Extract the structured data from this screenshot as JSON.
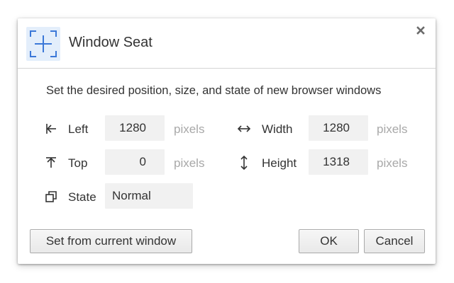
{
  "dialog": {
    "title": "Window Seat",
    "app_icon": "window-frame-icon",
    "close_icon": "close-icon"
  },
  "subtitle": "Set the desired position, size, and state of new browser windows",
  "fields": {
    "left": {
      "label": "Left",
      "value": "1280",
      "unit": "pixels",
      "icon": "align-left-edge-icon"
    },
    "top": {
      "label": "Top",
      "value": "0",
      "unit": "pixels",
      "icon": "align-top-edge-icon"
    },
    "width": {
      "label": "Width",
      "value": "1280",
      "unit": "pixels",
      "icon": "horizontal-arrows-icon"
    },
    "height": {
      "label": "Height",
      "value": "1318",
      "unit": "pixels",
      "icon": "vertical-arrows-icon"
    },
    "state": {
      "label": "State",
      "value": "Normal",
      "icon": "window-restore-icon"
    }
  },
  "buttons": {
    "set_from_current": "Set from current window",
    "ok": "OK",
    "cancel": "Cancel"
  },
  "colors": {
    "accent": "#3b78d8",
    "icon_bg": "#e3eefb",
    "field_bg": "#f1f1f1",
    "unit_text": "#a8a8a8"
  }
}
